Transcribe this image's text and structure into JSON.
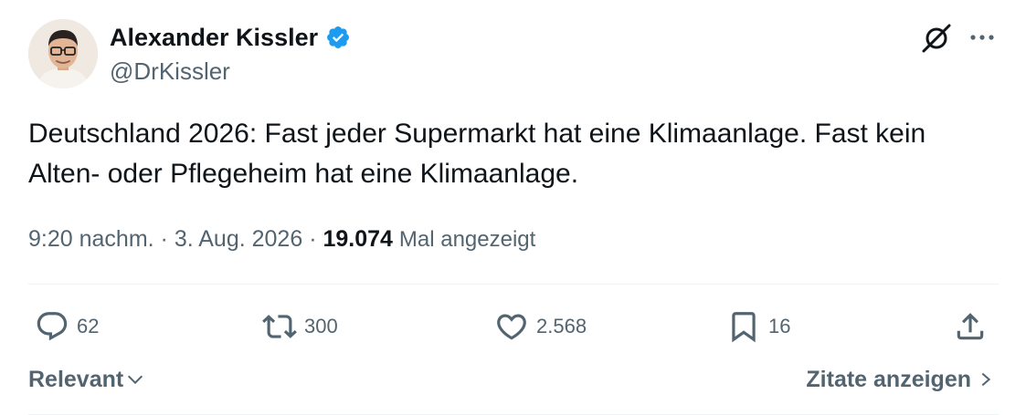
{
  "author": {
    "display_name": "Alexander Kissler",
    "handle": "@DrKissler",
    "verified": true,
    "avatar_icon": "person-avatar"
  },
  "header_icons": {
    "grok": "grok-icon",
    "more": "more-icon"
  },
  "tweet": {
    "text": "Deutschland 2026: Fast jeder Supermarkt hat eine Klimaanlage. Fast kein Alten- oder Pflegeheim hat eine Klimaanlage."
  },
  "meta": {
    "time": "9:20 nachm.",
    "separator": "·",
    "date": "3. Aug. 2026",
    "views_count": "19.074",
    "views_label": "Mal angezeigt"
  },
  "actions": {
    "replies": "62",
    "reposts": "300",
    "likes": "2.568",
    "bookmarks": "16"
  },
  "footer": {
    "sort_label": "Relevant",
    "quotes_label": "Zitate anzeigen"
  },
  "colors": {
    "text_primary": "#0f1419",
    "text_secondary": "#536471",
    "verified_blue": "#1d9bf0",
    "divider": "#eff3f4"
  }
}
